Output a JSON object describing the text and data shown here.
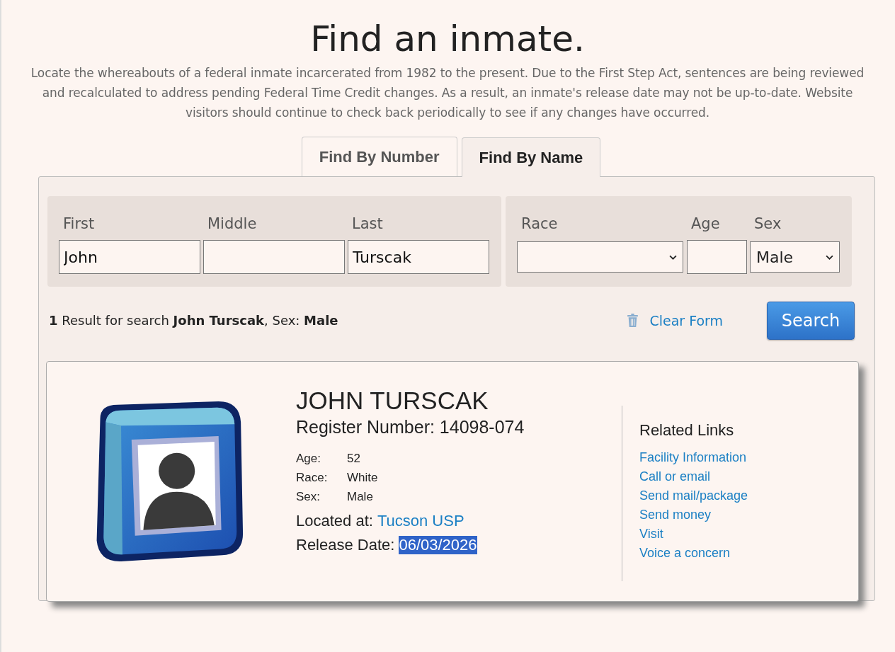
{
  "heading": "Find an inmate.",
  "intro": "Locate the whereabouts of a federal inmate incarcerated from 1982 to the present. Due to the First Step Act, sentences are being reviewed and recalculated to address pending Federal Time Credit changes. As a result, an inmate's release date may not be up-to-date. Website visitors should continue to check back periodically to see if any changes have occurred.",
  "tabs": [
    {
      "label": "Find By Number",
      "selected": false
    },
    {
      "label": "Find By Name",
      "selected": true
    }
  ],
  "name_fields": [
    {
      "label": "First",
      "kind": "text",
      "value": "John"
    },
    {
      "label": "Middle",
      "kind": "text"
    },
    {
      "label": "Last",
      "kind": "text",
      "value": "Turscak"
    }
  ],
  "detail_fields": [
    {
      "label": "Race",
      "kind": "select"
    },
    {
      "label": "Age",
      "kind": "text"
    },
    {
      "label": "Sex",
      "kind": "select",
      "value": "Male"
    }
  ],
  "result_summary": "**1** Result for search **John Turscak**, Sex: **Male**",
  "clear_button": "Clear Form",
  "search_button": "Search",
  "result": {
    "name": "JOHN TURSCAK",
    "register_number": "Register Number: 14098-074",
    "facts": [
      {
        "label": "Age:",
        "value": "52"
      },
      {
        "label": "Race:",
        "value": "White"
      },
      {
        "label": "Sex:",
        "value": "Male"
      }
    ],
    "location_label": "Located at:",
    "location": "Tucson USP",
    "release_label": "Release Date:",
    "release_date": "06/03/2026",
    "release_date_highlighted": true,
    "links_title": "Related Links",
    "links": [
      "Facility Information",
      "Call or email",
      "Send mail/package",
      "Send money",
      "Visit",
      "Voice a concern"
    ]
  }
}
